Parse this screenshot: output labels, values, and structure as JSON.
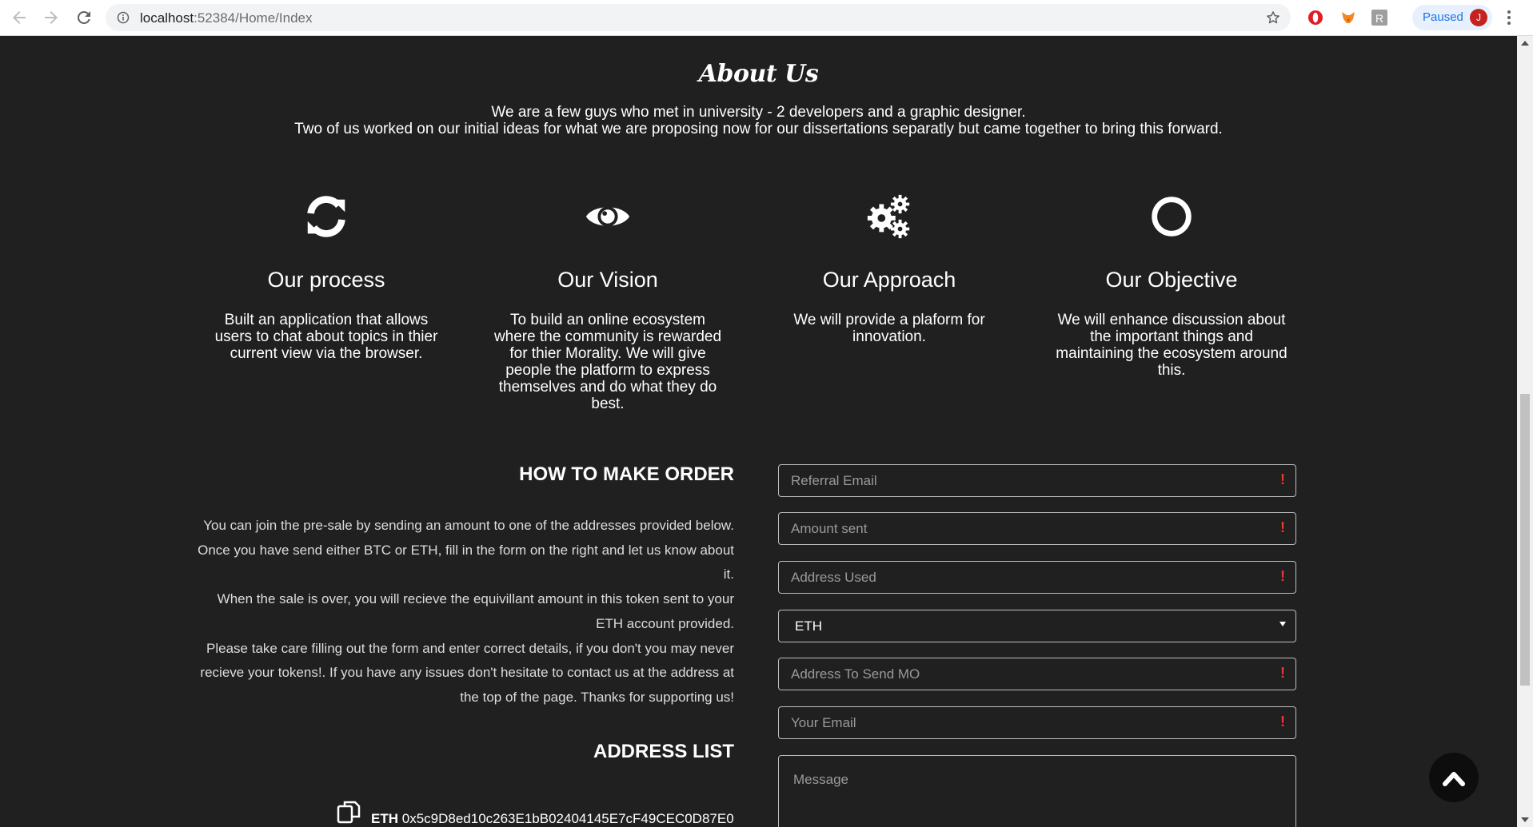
{
  "browser": {
    "url_host": "localhost",
    "url_path": ":52384/Home/Index",
    "extension_r": "R",
    "profile_status": "Paused",
    "avatar_initial": "J"
  },
  "about": {
    "title": "About Us",
    "line1": "We are a few guys who met in university - 2 developers and a graphic designer.",
    "line2": "Two of us worked on our initial ideas for what we are proposing now for our dissertations separatly but came together to bring this forward."
  },
  "features": [
    {
      "icon": "refresh-icon",
      "title": "Our process",
      "description": "Built an application that allows users to chat about topics in thier current view via the browser."
    },
    {
      "icon": "eye-icon",
      "title": "Our Vision",
      "description": "To build an online ecosystem where the community is rewarded for thier Morality. We will give people the platform to express themselves and do what they do best."
    },
    {
      "icon": "gears-icon",
      "title": "Our Approach",
      "description": "We will provide a plaform for innovation."
    },
    {
      "icon": "circle-icon",
      "title": "Our Objective",
      "description": "We will enhance discussion about the important things and maintaining the ecosystem around this."
    }
  ],
  "order": {
    "title": "HOW TO MAKE ORDER",
    "p1": "You can join the pre-sale by sending an amount to one of the addresses provided below. Once you have send either BTC or ETH, fill in the form on the right and let us know about it.",
    "p2": "When the sale is over, you will recieve the equivillant amount in this token sent to your ETH account provided.",
    "p3": "Please take care filling out the form and enter correct details, if you don't you may never recieve your tokens!. If you have any issues don't hesitate to contact us at the address at the top of the page. Thanks for supporting us!"
  },
  "address_list": {
    "title": "ADDRESS LIST",
    "eth_label": "ETH",
    "eth_address": "0x5c9D8ed10c263E1bB02404145E7cF49CEC0D87E0"
  },
  "form": {
    "referral_placeholder": "Referral Email",
    "amount_placeholder": "Amount sent",
    "address_used_placeholder": "Address Used",
    "currency_value": "ETH",
    "address_send_placeholder": "Address To Send MO",
    "email_placeholder": "Your Email",
    "message_placeholder": "Message",
    "required_mark": "!"
  },
  "colors": {
    "page_bg": "#202020",
    "text": "#ffffff",
    "required": "#e53935"
  }
}
